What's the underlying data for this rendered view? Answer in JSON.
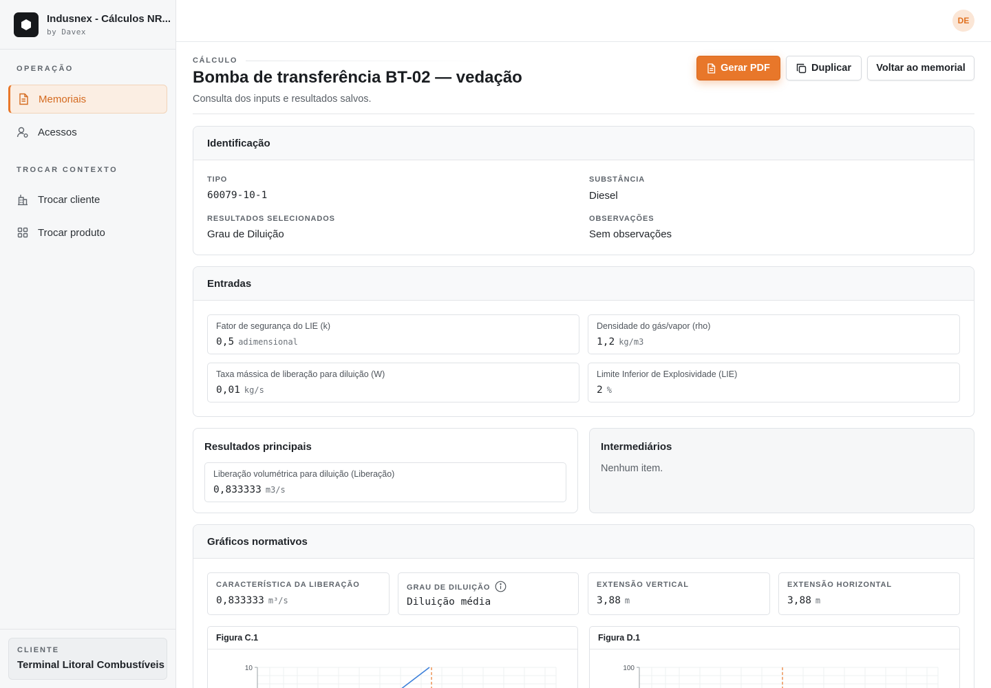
{
  "brand": {
    "title": "Indusnex - Cálculos NR...",
    "subtitle": "by Davex"
  },
  "sidebar": {
    "sections": [
      {
        "title": "OPERAÇÃO",
        "items": [
          {
            "label": "Memoriais",
            "icon": "document-icon",
            "active": true
          },
          {
            "label": "Acessos",
            "icon": "user-key-icon"
          }
        ]
      },
      {
        "title": "TROCAR CONTEXTO",
        "items": [
          {
            "label": "Trocar cliente",
            "icon": "building-icon"
          },
          {
            "label": "Trocar produto",
            "icon": "grid-icon"
          }
        ]
      }
    ],
    "client": {
      "label": "CLIENTE",
      "name": "Terminal Litoral Combustíveis"
    }
  },
  "topbar": {
    "avatar_initials": "DE"
  },
  "header": {
    "eyebrow": "CÁLCULO",
    "title": "Bomba de transferência BT-02 — vedação",
    "subtitle": "Consulta dos inputs e resultados salvos.",
    "actions": {
      "pdf": "Gerar PDF",
      "duplicate": "Duplicar",
      "back": "Voltar ao memorial"
    }
  },
  "identificacao": {
    "title": "Identificação",
    "fields": [
      {
        "label": "TIPO",
        "value": "60079-10-1",
        "mono": true
      },
      {
        "label": "SUBSTÂNCIA",
        "value": "Diesel"
      },
      {
        "label": "RESULTADOS SELECIONADOS",
        "value": "Grau de Diluição"
      },
      {
        "label": "OBSERVAÇÕES",
        "value": "Sem observações"
      }
    ]
  },
  "entradas": {
    "title": "Entradas",
    "items": [
      {
        "label": "Fator de segurança do LIE (k)",
        "value": "0,5",
        "unit": "adimensional"
      },
      {
        "label": "Densidade do gás/vapor (rho)",
        "value": "1,2",
        "unit": "kg/m3"
      },
      {
        "label": "Taxa mássica de liberação para diluição (W)",
        "value": "0,01",
        "unit": "kg/s"
      },
      {
        "label": "Limite Inferior de Explosividade (LIE)",
        "value": "2",
        "unit": "%"
      }
    ]
  },
  "resultados": {
    "title": "Resultados principais",
    "items": [
      {
        "label": "Liberação volumétrica para diluição (Liberação)",
        "value": "0,833333",
        "unit": "m3/s"
      }
    ]
  },
  "intermediarios": {
    "title": "Intermediários",
    "empty": "Nenhum item."
  },
  "graficos": {
    "title": "Gráficos normativos",
    "stats": [
      {
        "label": "CARACTERÍSTICA DA LIBERAÇÃO",
        "value": "0,833333",
        "unit": "m³/s"
      },
      {
        "label": "GRAU DE DILUIÇÃO",
        "value": "Diluição média",
        "unit": "",
        "info": true
      },
      {
        "label": "EXTENSÃO VERTICAL",
        "value": "3,88",
        "unit": "m"
      },
      {
        "label": "EXTENSÃO HORIZONTAL",
        "value": "3,88",
        "unit": "m"
      }
    ],
    "figures": [
      {
        "title": "Figura C.1",
        "y_tick": "10"
      },
      {
        "title": "Figura D.1",
        "y_tick": "100"
      }
    ]
  },
  "colors": {
    "accent": "#e8772a",
    "line_blue": "#3b7fd9",
    "line_red": "#e0312b"
  }
}
